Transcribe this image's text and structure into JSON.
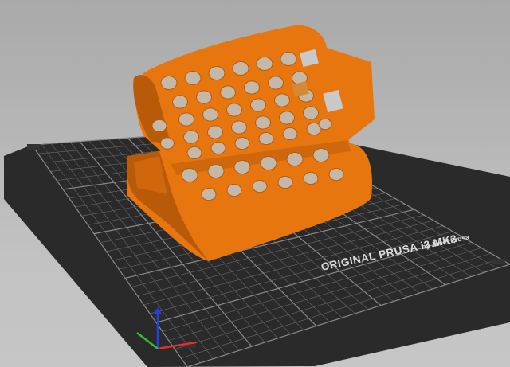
{
  "bed": {
    "brand_line": "ORIGINAL PRUSA i3  MK3",
    "byline": "by Josef Prusa"
  },
  "model": {
    "color": "#e8760f",
    "shade": "#b85a08",
    "hole_color": "#f08a2a"
  },
  "axes": {
    "x_color": "#e03030",
    "y_color": "#30c030",
    "z_color": "#2040e0"
  },
  "colors": {
    "bed_dark": "#2a2a2a",
    "grid_line": "#6a6a6a",
    "grid_major": "#8a8a8a",
    "bed_text": "#dcdcdc"
  }
}
